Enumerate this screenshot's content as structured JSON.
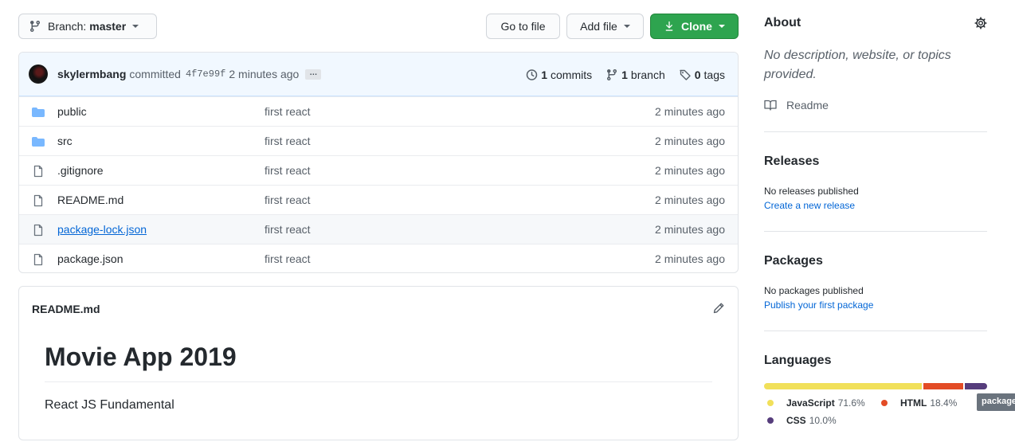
{
  "toolbar": {
    "branch_label": "Branch:",
    "branch_value": "master",
    "goto_file": "Go to file",
    "add_file": "Add file",
    "clone": "Clone"
  },
  "commit": {
    "user": "skylermbang",
    "text": "committed",
    "sha": "4f7e99f",
    "time": "2 minutes ago",
    "ellipsis": "…",
    "commits_count": "1",
    "commits_label": "commits",
    "branch_count": "1",
    "branch_label": "branch",
    "tags_count": "0",
    "tags_label": "tags"
  },
  "files": [
    {
      "name": "public",
      "type": "folder",
      "message": "first react",
      "time": "2 minutes ago"
    },
    {
      "name": "src",
      "type": "folder",
      "message": "first react",
      "time": "2 minutes ago"
    },
    {
      "name": ".gitignore",
      "type": "file",
      "message": "first react",
      "time": "2 minutes ago"
    },
    {
      "name": "README.md",
      "type": "file",
      "message": "first react",
      "time": "2 minutes ago"
    },
    {
      "name": "package-lock.json",
      "type": "file",
      "message": "first react",
      "time": "2 minutes ago"
    },
    {
      "name": "package.json",
      "type": "file",
      "message": "first react",
      "time": "2 minutes ago"
    }
  ],
  "readme": {
    "filename": "README.md",
    "title": "Movie App 2019",
    "body": "React JS Fundamental"
  },
  "sidebar": {
    "about_title": "About",
    "about_desc": "No description, website, or topics provided.",
    "readme_label": "Readme",
    "releases_title": "Releases",
    "releases_none": "No releases published",
    "releases_link": "Create a new release",
    "packages_title": "Packages",
    "packages_none": "No packages published",
    "packages_link": "Publish your first package",
    "languages_title": "Languages",
    "languages": [
      {
        "name": "JavaScript",
        "percent": "71.6%",
        "value": 71.6,
        "color": "#f1e05a"
      },
      {
        "name": "HTML",
        "percent": "18.4%",
        "value": 18.4,
        "color": "#e34c26"
      },
      {
        "name": "CSS",
        "percent": "10.0%",
        "value": 10.0,
        "color": "#563d7c"
      }
    ],
    "tooltip": "package"
  },
  "colors": {
    "accent_link": "#0366d6",
    "clone_green": "#2ea44f",
    "folder_blue": "#79b8ff"
  }
}
